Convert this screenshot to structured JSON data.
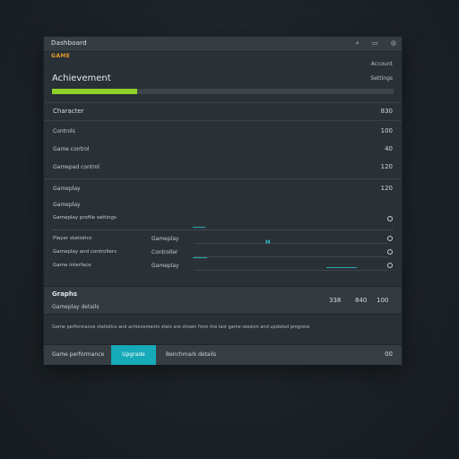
{
  "window": {
    "title": "Dashboard",
    "icons": [
      "search-icon",
      "settings-icon",
      "user-icon"
    ]
  },
  "brand": {
    "label": "GAME"
  },
  "header": {
    "link1": "Account",
    "link2": "Settings"
  },
  "main": {
    "heading": "Achievement",
    "progress_fraction": 0.25,
    "section_label": "Character",
    "section_value": "830"
  },
  "rows": [
    {
      "label": "Controls",
      "value": "100"
    },
    {
      "label": "Game control",
      "value": "40"
    },
    {
      "label": "Gamepad control",
      "value": "120"
    }
  ],
  "group": {
    "label": "Gameplay",
    "value": "120",
    "sub1": "Gameplay",
    "sub2": "Gameplay profile settings"
  },
  "settings": [
    {
      "label": "Player statistics",
      "mid": "Gameplay"
    },
    {
      "label": "Gameplay and controllers",
      "mid": "Controller"
    },
    {
      "label": "Game interface",
      "mid": "Gameplay"
    }
  ],
  "summary": {
    "title": "Graphs",
    "subtitle": "Gameplay details",
    "v1": "338",
    "v2": "840",
    "v3": "100"
  },
  "footnote": "Game performance statistics and achievements stats are shown from the last game session and updated progress",
  "bottom": {
    "left": "Game performance",
    "primary": "Upgrade",
    "mid": "Benchmark details",
    "right": "00"
  },
  "colors": {
    "accent_teal": "#16a9b7",
    "progress_green": "#8fd128",
    "brand_orange": "#e89a2b"
  }
}
